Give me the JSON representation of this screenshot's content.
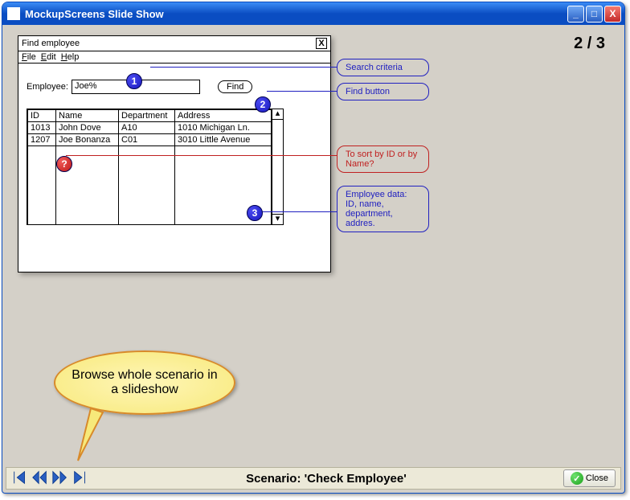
{
  "window": {
    "title": "MockupScreens Slide Show"
  },
  "titlebar_buttons": {
    "minimize": "_",
    "maximize": "□",
    "close": "X"
  },
  "page_counter": "2 / 3",
  "mock": {
    "title": "Find employee",
    "menu": {
      "file": "File",
      "edit": "Edit",
      "help": "Help"
    },
    "employee_label": "Employee:",
    "employee_value": "Joe%",
    "find_label": "Find",
    "columns": {
      "id": "ID",
      "name": "Name",
      "dept": "Department",
      "addr": "Address"
    },
    "rows": [
      {
        "id": "1013",
        "name": "John Dove",
        "dept": "A10",
        "addr": "1010 Michigan Ln."
      },
      {
        "id": "1207",
        "name": "Joe Bonanza",
        "dept": "C01",
        "addr": "3010 Little Avenue"
      }
    ]
  },
  "callouts": {
    "c1": "Search criteria",
    "c2": "Find button",
    "c3": "To sort by ID or by Name?",
    "c4": "Employee data: ID, name, department, addres."
  },
  "markers": {
    "m1": "1",
    "m2": "2",
    "m3": "3",
    "q": "?"
  },
  "bubble": "Browse whole scenario in a slideshow",
  "bottom": {
    "scenario": "Scenario: 'Check Employee'",
    "close": "Close"
  }
}
